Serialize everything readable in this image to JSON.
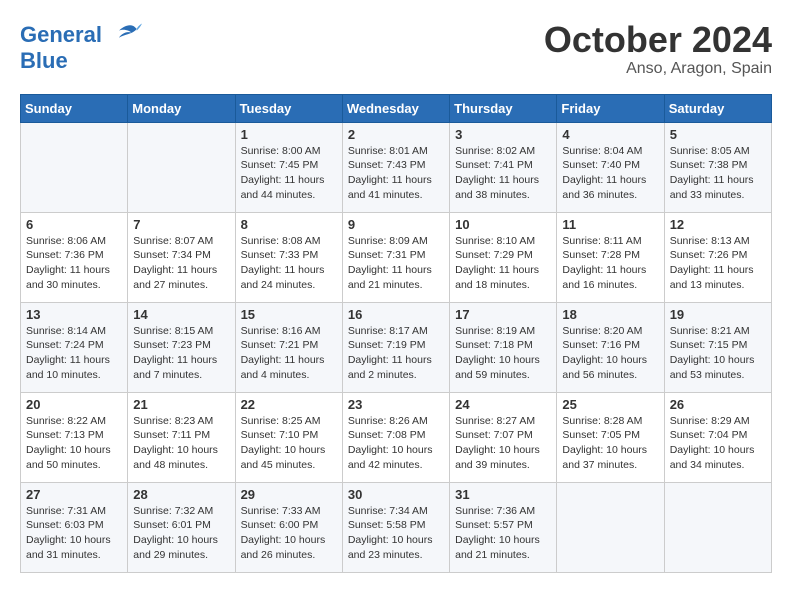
{
  "header": {
    "logo_line1": "General",
    "logo_line2": "Blue",
    "month": "October 2024",
    "location": "Anso, Aragon, Spain"
  },
  "weekdays": [
    "Sunday",
    "Monday",
    "Tuesday",
    "Wednesday",
    "Thursday",
    "Friday",
    "Saturday"
  ],
  "weeks": [
    [
      {
        "day": "",
        "sunrise": "",
        "sunset": "",
        "daylight": ""
      },
      {
        "day": "",
        "sunrise": "",
        "sunset": "",
        "daylight": ""
      },
      {
        "day": "1",
        "sunrise": "Sunrise: 8:00 AM",
        "sunset": "Sunset: 7:45 PM",
        "daylight": "Daylight: 11 hours and 44 minutes."
      },
      {
        "day": "2",
        "sunrise": "Sunrise: 8:01 AM",
        "sunset": "Sunset: 7:43 PM",
        "daylight": "Daylight: 11 hours and 41 minutes."
      },
      {
        "day": "3",
        "sunrise": "Sunrise: 8:02 AM",
        "sunset": "Sunset: 7:41 PM",
        "daylight": "Daylight: 11 hours and 38 minutes."
      },
      {
        "day": "4",
        "sunrise": "Sunrise: 8:04 AM",
        "sunset": "Sunset: 7:40 PM",
        "daylight": "Daylight: 11 hours and 36 minutes."
      },
      {
        "day": "5",
        "sunrise": "Sunrise: 8:05 AM",
        "sunset": "Sunset: 7:38 PM",
        "daylight": "Daylight: 11 hours and 33 minutes."
      }
    ],
    [
      {
        "day": "6",
        "sunrise": "Sunrise: 8:06 AM",
        "sunset": "Sunset: 7:36 PM",
        "daylight": "Daylight: 11 hours and 30 minutes."
      },
      {
        "day": "7",
        "sunrise": "Sunrise: 8:07 AM",
        "sunset": "Sunset: 7:34 PM",
        "daylight": "Daylight: 11 hours and 27 minutes."
      },
      {
        "day": "8",
        "sunrise": "Sunrise: 8:08 AM",
        "sunset": "Sunset: 7:33 PM",
        "daylight": "Daylight: 11 hours and 24 minutes."
      },
      {
        "day": "9",
        "sunrise": "Sunrise: 8:09 AM",
        "sunset": "Sunset: 7:31 PM",
        "daylight": "Daylight: 11 hours and 21 minutes."
      },
      {
        "day": "10",
        "sunrise": "Sunrise: 8:10 AM",
        "sunset": "Sunset: 7:29 PM",
        "daylight": "Daylight: 11 hours and 18 minutes."
      },
      {
        "day": "11",
        "sunrise": "Sunrise: 8:11 AM",
        "sunset": "Sunset: 7:28 PM",
        "daylight": "Daylight: 11 hours and 16 minutes."
      },
      {
        "day": "12",
        "sunrise": "Sunrise: 8:13 AM",
        "sunset": "Sunset: 7:26 PM",
        "daylight": "Daylight: 11 hours and 13 minutes."
      }
    ],
    [
      {
        "day": "13",
        "sunrise": "Sunrise: 8:14 AM",
        "sunset": "Sunset: 7:24 PM",
        "daylight": "Daylight: 11 hours and 10 minutes."
      },
      {
        "day": "14",
        "sunrise": "Sunrise: 8:15 AM",
        "sunset": "Sunset: 7:23 PM",
        "daylight": "Daylight: 11 hours and 7 minutes."
      },
      {
        "day": "15",
        "sunrise": "Sunrise: 8:16 AM",
        "sunset": "Sunset: 7:21 PM",
        "daylight": "Daylight: 11 hours and 4 minutes."
      },
      {
        "day": "16",
        "sunrise": "Sunrise: 8:17 AM",
        "sunset": "Sunset: 7:19 PM",
        "daylight": "Daylight: 11 hours and 2 minutes."
      },
      {
        "day": "17",
        "sunrise": "Sunrise: 8:19 AM",
        "sunset": "Sunset: 7:18 PM",
        "daylight": "Daylight: 10 hours and 59 minutes."
      },
      {
        "day": "18",
        "sunrise": "Sunrise: 8:20 AM",
        "sunset": "Sunset: 7:16 PM",
        "daylight": "Daylight: 10 hours and 56 minutes."
      },
      {
        "day": "19",
        "sunrise": "Sunrise: 8:21 AM",
        "sunset": "Sunset: 7:15 PM",
        "daylight": "Daylight: 10 hours and 53 minutes."
      }
    ],
    [
      {
        "day": "20",
        "sunrise": "Sunrise: 8:22 AM",
        "sunset": "Sunset: 7:13 PM",
        "daylight": "Daylight: 10 hours and 50 minutes."
      },
      {
        "day": "21",
        "sunrise": "Sunrise: 8:23 AM",
        "sunset": "Sunset: 7:11 PM",
        "daylight": "Daylight: 10 hours and 48 minutes."
      },
      {
        "day": "22",
        "sunrise": "Sunrise: 8:25 AM",
        "sunset": "Sunset: 7:10 PM",
        "daylight": "Daylight: 10 hours and 45 minutes."
      },
      {
        "day": "23",
        "sunrise": "Sunrise: 8:26 AM",
        "sunset": "Sunset: 7:08 PM",
        "daylight": "Daylight: 10 hours and 42 minutes."
      },
      {
        "day": "24",
        "sunrise": "Sunrise: 8:27 AM",
        "sunset": "Sunset: 7:07 PM",
        "daylight": "Daylight: 10 hours and 39 minutes."
      },
      {
        "day": "25",
        "sunrise": "Sunrise: 8:28 AM",
        "sunset": "Sunset: 7:05 PM",
        "daylight": "Daylight: 10 hours and 37 minutes."
      },
      {
        "day": "26",
        "sunrise": "Sunrise: 8:29 AM",
        "sunset": "Sunset: 7:04 PM",
        "daylight": "Daylight: 10 hours and 34 minutes."
      }
    ],
    [
      {
        "day": "27",
        "sunrise": "Sunrise: 7:31 AM",
        "sunset": "Sunset: 6:03 PM",
        "daylight": "Daylight: 10 hours and 31 minutes."
      },
      {
        "day": "28",
        "sunrise": "Sunrise: 7:32 AM",
        "sunset": "Sunset: 6:01 PM",
        "daylight": "Daylight: 10 hours and 29 minutes."
      },
      {
        "day": "29",
        "sunrise": "Sunrise: 7:33 AM",
        "sunset": "Sunset: 6:00 PM",
        "daylight": "Daylight: 10 hours and 26 minutes."
      },
      {
        "day": "30",
        "sunrise": "Sunrise: 7:34 AM",
        "sunset": "Sunset: 5:58 PM",
        "daylight": "Daylight: 10 hours and 23 minutes."
      },
      {
        "day": "31",
        "sunrise": "Sunrise: 7:36 AM",
        "sunset": "Sunset: 5:57 PM",
        "daylight": "Daylight: 10 hours and 21 minutes."
      },
      {
        "day": "",
        "sunrise": "",
        "sunset": "",
        "daylight": ""
      },
      {
        "day": "",
        "sunrise": "",
        "sunset": "",
        "daylight": ""
      }
    ]
  ]
}
